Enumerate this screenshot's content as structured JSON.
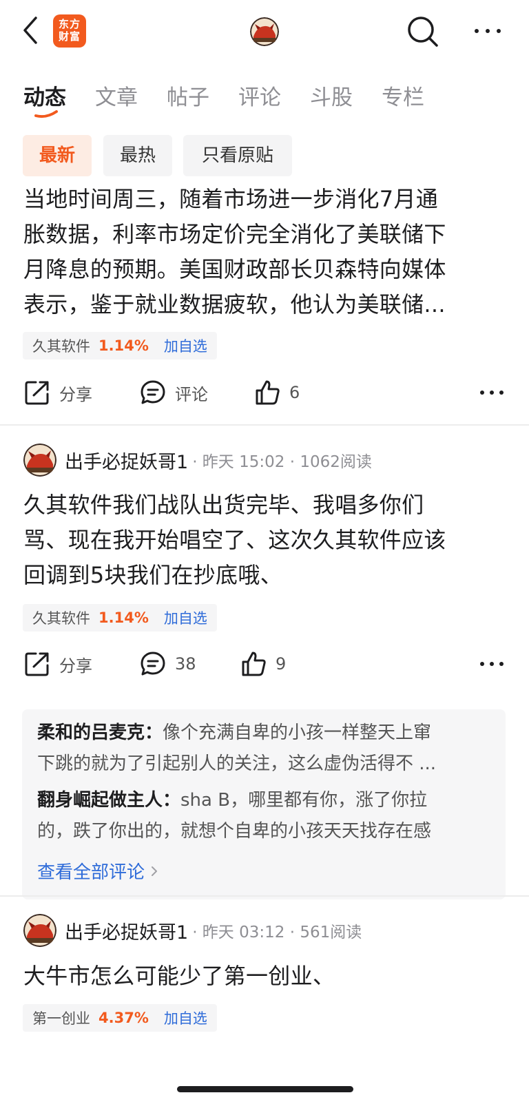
{
  "header": {
    "logo_line1": "东方",
    "logo_line2": "财富"
  },
  "tabs": [
    {
      "label": "动态",
      "active": true
    },
    {
      "label": "文章",
      "active": false
    },
    {
      "label": "帖子",
      "active": false
    },
    {
      "label": "评论",
      "active": false
    },
    {
      "label": "斗股",
      "active": false
    },
    {
      "label": "专栏",
      "active": false
    }
  ],
  "filters": [
    {
      "label": "最新",
      "active": true
    },
    {
      "label": "最热",
      "active": false
    },
    {
      "label": "只看原贴",
      "active": false
    }
  ],
  "posts": [
    {
      "lines": [
        "当地时间周三，随着市场进一步消化7月通",
        "胀数据，利率市场定价完全消化了美联储下",
        "月降息的预期。美国财政部长贝森特向媒体",
        "表示，鉴于就业数据疲软，他认为美联储..."
      ],
      "stock": {
        "name": "久其软件",
        "pct": "1.14%",
        "add": "加自选"
      },
      "actions": {
        "share": "分享",
        "comment": "评论",
        "like": "6"
      }
    },
    {
      "author": "出手必捉妖哥1",
      "meta": "· 昨天 15:02 · 1062阅读",
      "lines": [
        "久其软件我们战队出货完毕、我唱多你们",
        "骂、现在我开始唱空了、这次久其软件应该",
        "回调到5块我们在抄底哦、"
      ],
      "stock": {
        "name": "久其软件",
        "pct": "1.14%",
        "add": "加自选"
      },
      "actions": {
        "share": "分享",
        "comment": "38",
        "like": "9"
      },
      "comments": [
        {
          "user": "柔和的吕麦克：",
          "line1": "像个充满自卑的小孩一样整天上窜",
          "line2": "下跳的就为了引起别人的关注，这么虚伪活得不 ..."
        },
        {
          "user": "翻身崛起做主人：",
          "line1": "sha B，哪里都有你，涨了你拉",
          "line2": "的，跌了你出的，就想个自卑的小孩天天找存在感"
        }
      ],
      "view_all": "查看全部评论"
    },
    {
      "author": "出手必捉妖哥1",
      "meta": "· 昨天 03:12 · 561阅读",
      "lines": [
        "大牛市怎么可能少了第一创业、"
      ],
      "stock": {
        "name": "第一创业",
        "pct": "4.37%",
        "add": "加自选"
      }
    }
  ],
  "colors": {
    "accent": "#f25a1e",
    "link": "#2f6cd9",
    "text": "#1d1d1f",
    "muted": "#8e8e93"
  }
}
